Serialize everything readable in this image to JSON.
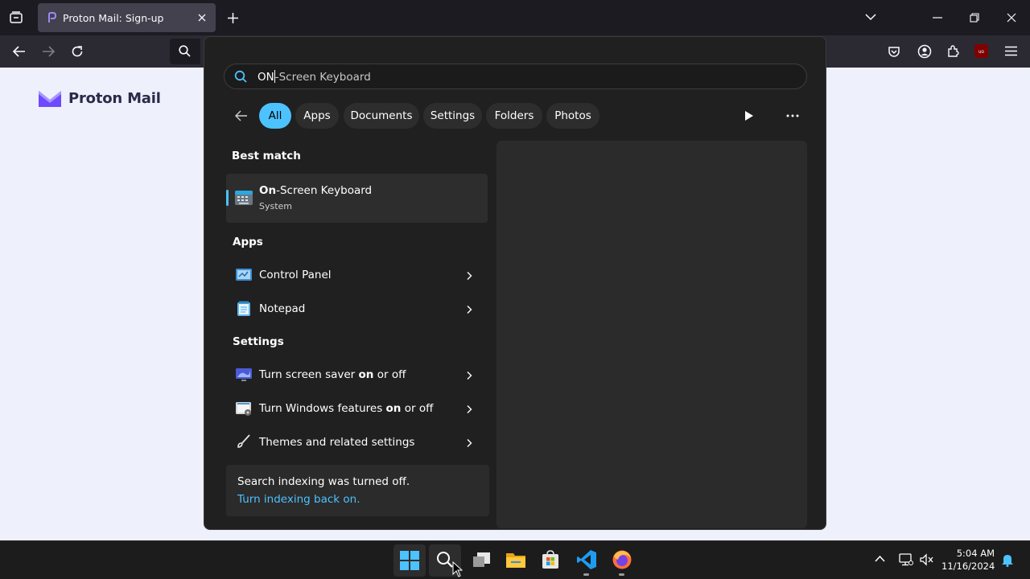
{
  "browser": {
    "tab_title": "Proton Mail: Sign-up",
    "brand": "Proton Mail"
  },
  "search": {
    "typed": "ON",
    "rest": "-Screen Keyboard",
    "filters": [
      "All",
      "Apps",
      "Documents",
      "Settings",
      "Folders",
      "Photos"
    ],
    "active_filter": "All"
  },
  "results": {
    "best_match_heading": "Best match",
    "best_match": {
      "bold": "On",
      "rest": "-Screen Keyboard",
      "subtitle": "System"
    },
    "apps_heading": "Apps",
    "apps": [
      "Control Panel",
      "Notepad"
    ],
    "settings_heading": "Settings",
    "settings": [
      {
        "pre": "Turn screen saver ",
        "bold": "on",
        "post": " or off"
      },
      {
        "pre": "Turn Windows features ",
        "bold": "on",
        "post": " or off"
      },
      {
        "pre": "Themes and related settings",
        "bold": "",
        "post": ""
      }
    ],
    "index_message": "Search indexing was turned off.",
    "index_link": "Turn indexing back on."
  },
  "taskbar": {
    "time": "5:04 AM",
    "date": "11/16/2024"
  },
  "colors": {
    "accent": "#4cc2ff",
    "panel_bg": "#202020",
    "page_bg": "#eef0fb"
  }
}
